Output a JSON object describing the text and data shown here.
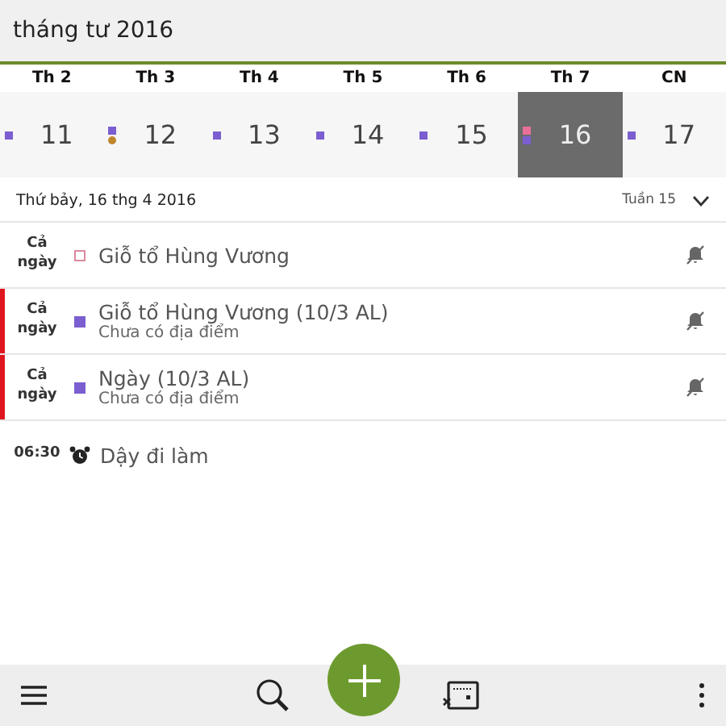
{
  "header": {
    "title": "tháng tư 2016"
  },
  "week": {
    "day_names": [
      "Th 2",
      "Th 3",
      "Th 4",
      "Th 5",
      "Th 6",
      "Th 7",
      "CN"
    ],
    "days": [
      {
        "date": "11",
        "selected": false,
        "markers": [
          {
            "kind": "square",
            "color": "#7b5fd0"
          }
        ]
      },
      {
        "date": "12",
        "selected": false,
        "markers": [
          {
            "kind": "square",
            "color": "#7b5fd0"
          },
          {
            "kind": "dot",
            "color": "#c0862c"
          }
        ]
      },
      {
        "date": "13",
        "selected": false,
        "markers": [
          {
            "kind": "square",
            "color": "#7b5fd0"
          }
        ]
      },
      {
        "date": "14",
        "selected": false,
        "markers": [
          {
            "kind": "square",
            "color": "#7b5fd0"
          }
        ]
      },
      {
        "date": "15",
        "selected": false,
        "markers": [
          {
            "kind": "square",
            "color": "#7b5fd0"
          }
        ]
      },
      {
        "date": "16",
        "selected": true,
        "markers": [
          {
            "kind": "square",
            "color": "#e8709a"
          },
          {
            "kind": "square",
            "color": "#7b5fd0"
          }
        ]
      },
      {
        "date": "17",
        "selected": false,
        "markers": [
          {
            "kind": "square",
            "color": "#7b5fd0"
          }
        ]
      }
    ]
  },
  "day_header": {
    "date": "Thứ bảy, 16 thg 4 2016",
    "week": "Tuần 15",
    "expanded": false
  },
  "events": [
    {
      "kind": "allday",
      "time": "Cả ngày",
      "flagged": false,
      "marker": {
        "kind": "hollow",
        "color": "#d98a9c"
      },
      "title": "Giỗ tổ Hùng Vương",
      "notifications_off": true
    },
    {
      "kind": "allday",
      "time": "Cả ngày",
      "flagged": true,
      "marker": {
        "kind": "solid",
        "color": "#7b5fd0"
      },
      "title": "Giỗ tổ Hùng Vương (10/3 AL)",
      "location": "Chưa có địa điểm",
      "notifications_off": true
    },
    {
      "kind": "allday",
      "time": "Cả ngày",
      "flagged": true,
      "marker": {
        "kind": "solid",
        "color": "#7b5fd0"
      },
      "title": "Ngày (10/3 AL)",
      "location": "Chưa có địa điểm",
      "notifications_off": true
    },
    {
      "kind": "alarm",
      "time": "06:30",
      "flagged": false,
      "title": "Dậy đi làm",
      "notifications_off": false
    }
  ]
}
